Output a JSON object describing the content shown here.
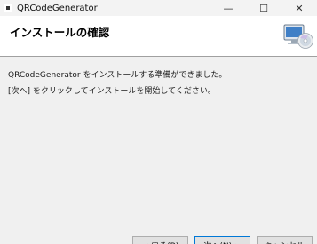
{
  "window": {
    "title": "QRCodeGenerator",
    "minimize_glyph": "—",
    "maximize_glyph": "☐",
    "close_glyph": "✕"
  },
  "header": {
    "title": "インストールの確認",
    "icon": "computer-disc-icon"
  },
  "body": {
    "line1": "QRCodeGenerator をインストールする準備ができました。",
    "line2": "[次へ] をクリックしてインストールを開始してください。"
  },
  "buttons": {
    "back_label": "< 戻る(B)",
    "next_label": "次へ(N) >",
    "cancel_label": "キャンセル"
  }
}
